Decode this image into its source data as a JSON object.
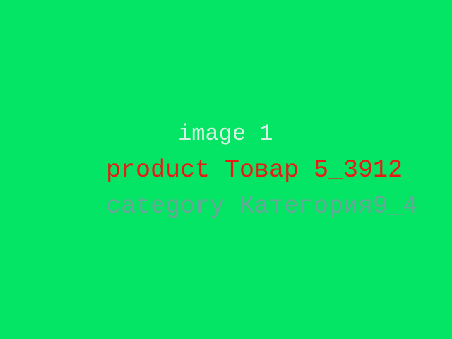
{
  "colors": {
    "background": "#05E565",
    "image_label": "#D8F0E2",
    "product_label": "#E81A14",
    "category_label": "#67A798"
  },
  "lines": {
    "image": "image 1",
    "product": "product Товар 5_3912",
    "category": "category Категория9_4"
  }
}
